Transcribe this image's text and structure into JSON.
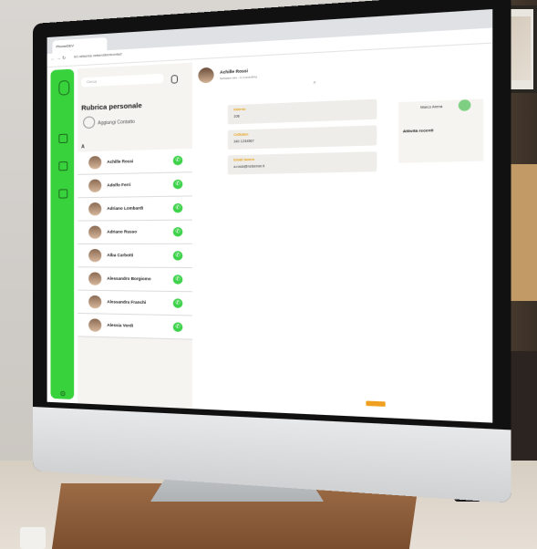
{
  "browser": {
    "tab_title": "PhoneDEV",
    "address": "le1.netsense.netsensibentcontact"
  },
  "app": {
    "brand_color": "#38d23c",
    "accent_color": "#e8a21a"
  },
  "search": {
    "placeholder": "Cerca"
  },
  "contacts": {
    "title": "Rubrica personale",
    "add_label": "Aggiungi Contatto",
    "letter": "A",
    "items": [
      "Achille Rossi",
      "Adolfo Ferri",
      "Adriano Lombardi",
      "Adriano Russo",
      "Alba Carbotti",
      "Alessandro Borgiomo",
      "Alessandra Franchi",
      "Alessia Verdi"
    ]
  },
  "detail": {
    "name": "Achille Rossi",
    "subtitle": "Software dev - C.Consulting",
    "fields": [
      {
        "label": "Interno",
        "value": "108"
      },
      {
        "label": "Cellulare",
        "value": "340 1234567"
      },
      {
        "label": "Email lavoro",
        "value": "a.rossi@netsense.it"
      }
    ]
  },
  "panel": {
    "user": "Marco Arena",
    "recent_title": "Attività recenti"
  }
}
